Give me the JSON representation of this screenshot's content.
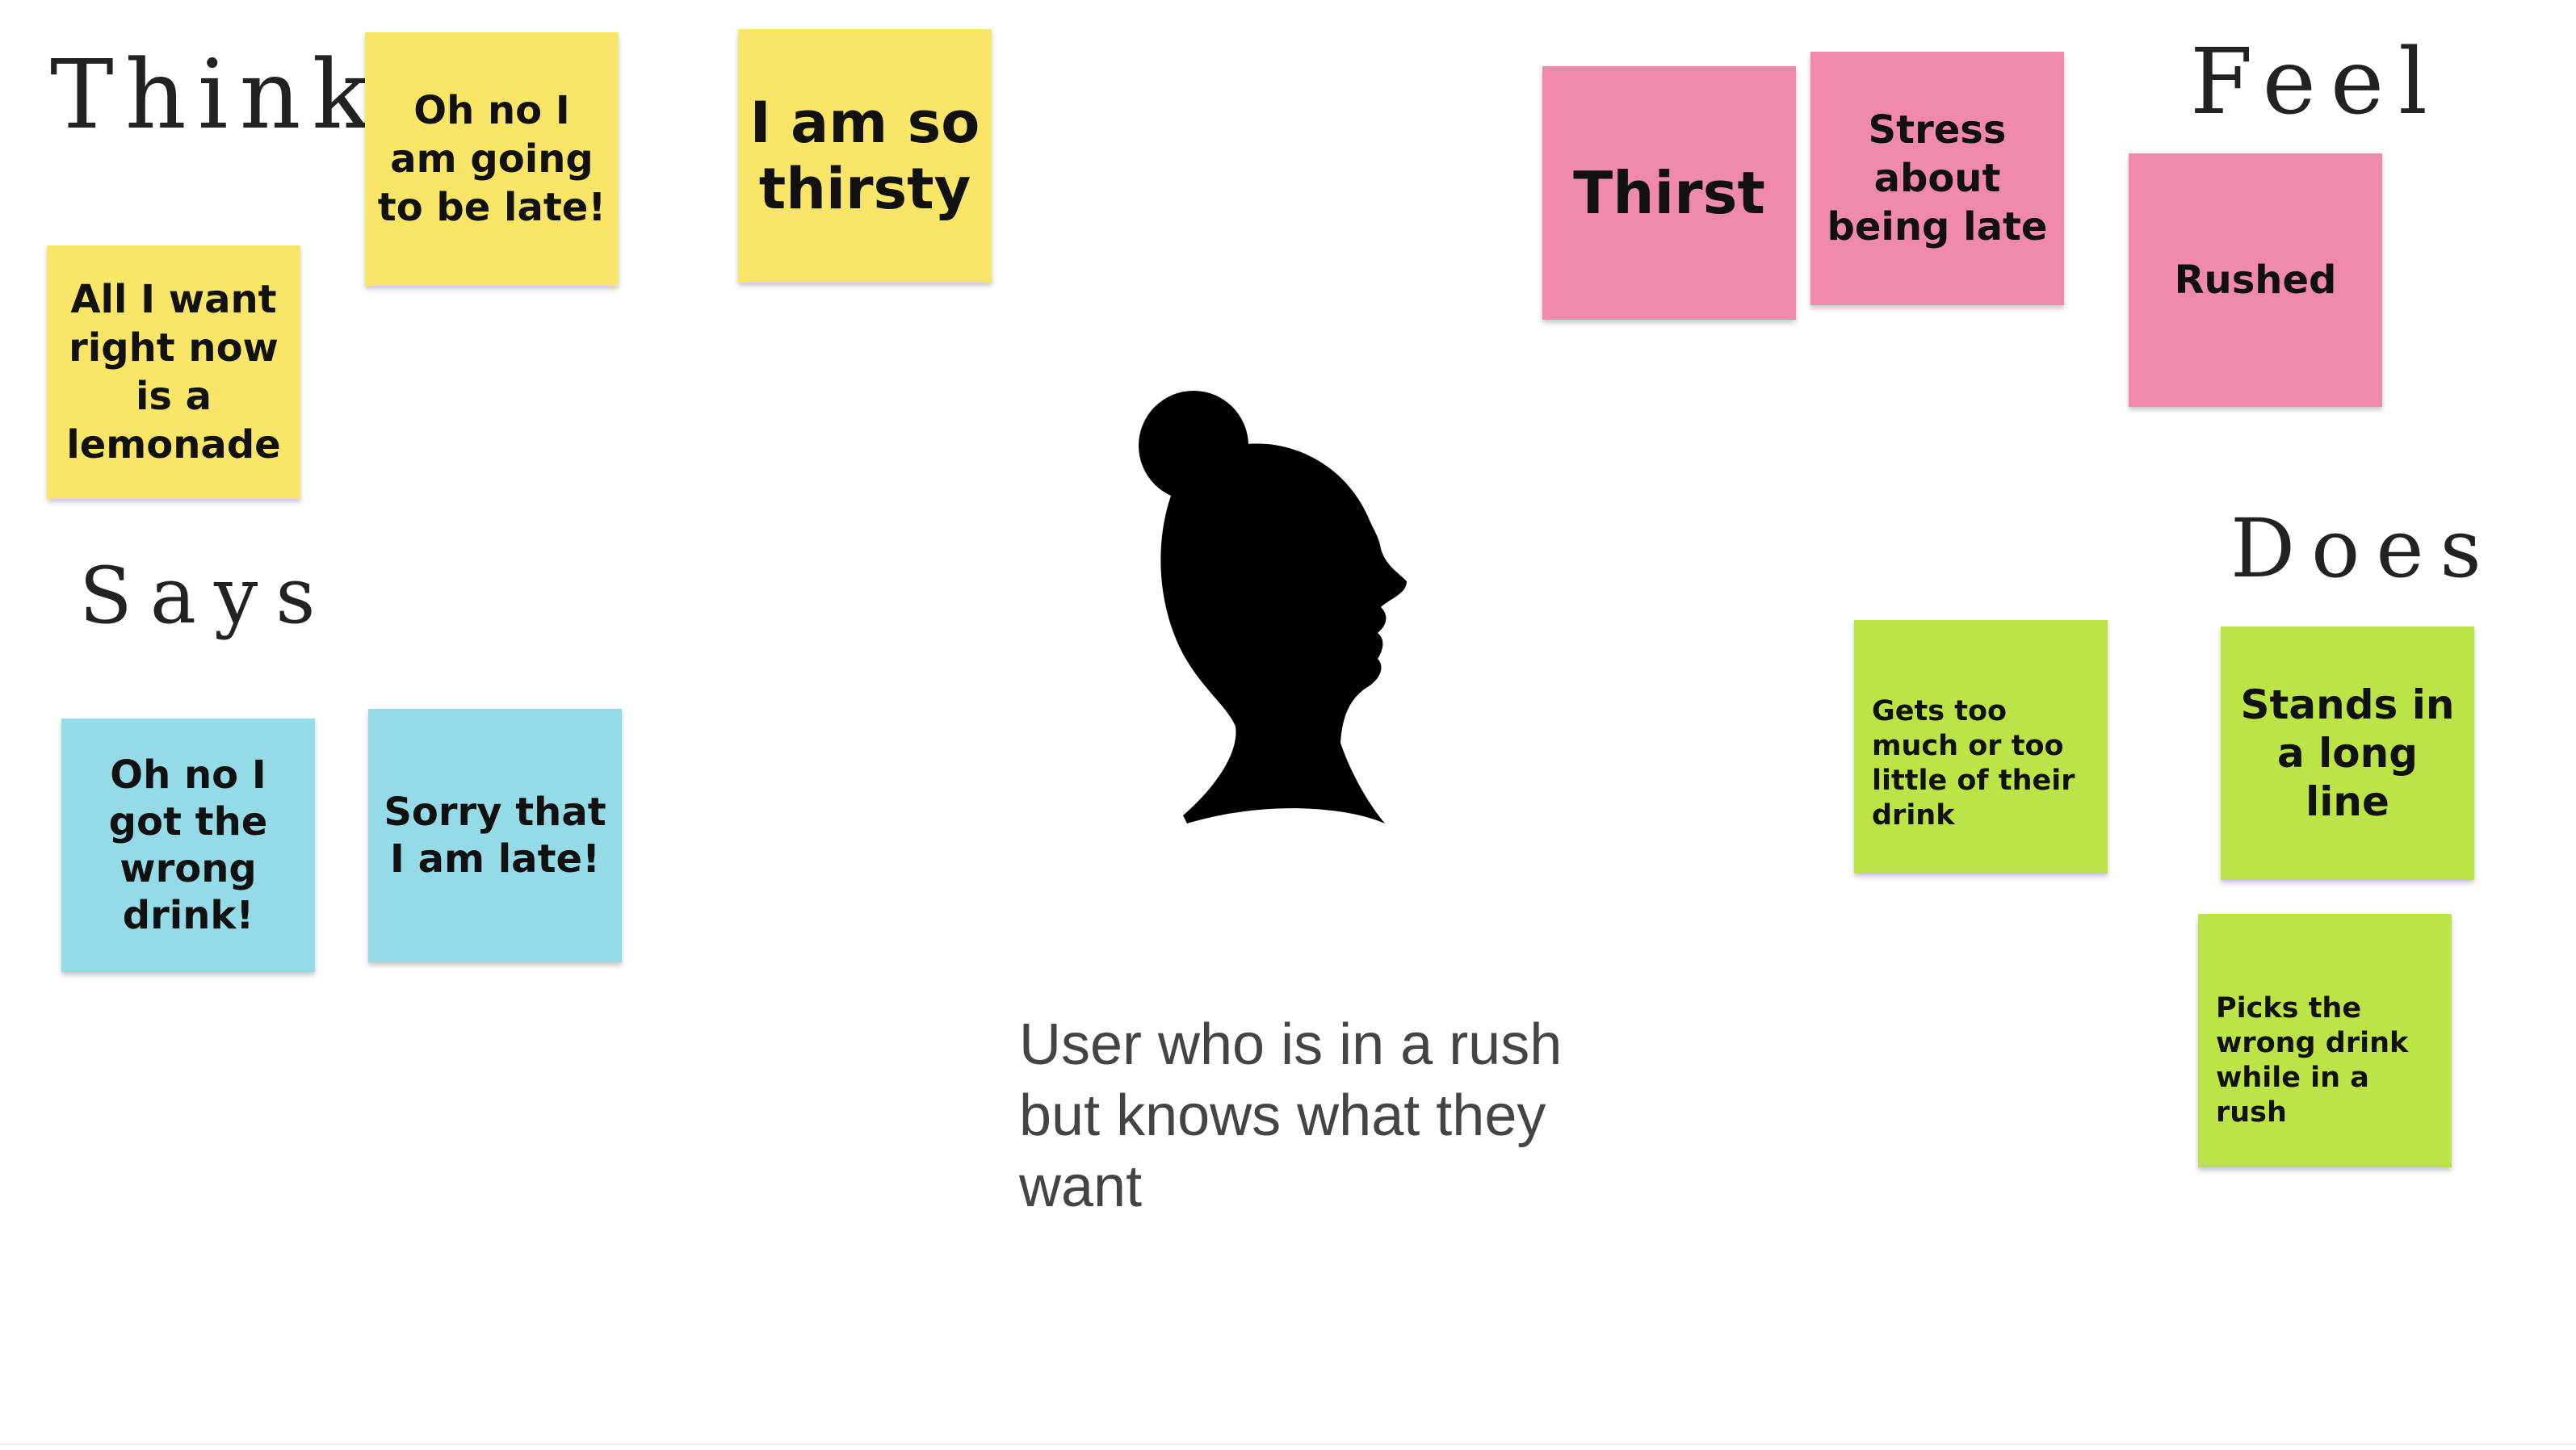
{
  "labels": {
    "think": "Think",
    "says": "Says",
    "feel": "Feel",
    "does": "Does"
  },
  "notes": {
    "think_1": "Oh no I am going to be late!",
    "think_2": "I am so thirsty",
    "think_3": "All I want right now is a lemonade",
    "says_1": "Oh no I got the wrong drink!",
    "says_2": "Sorry that I am late!",
    "feel_1": "Thirst",
    "feel_2": "Stress about being late",
    "feel_3": "Rushed",
    "does_1": "Gets too much or too little of their drink",
    "does_2": "Stands in a long line",
    "does_3": "Picks the wrong drink while in a rush"
  },
  "persona": {
    "caption": "User who is in a rush but knows what they want",
    "icon": "woman-head-silhouette-icon"
  },
  "colors": {
    "think": "#f9e567",
    "feel": "#f08aac",
    "says": "#95dae7",
    "does": "#bde447"
  }
}
